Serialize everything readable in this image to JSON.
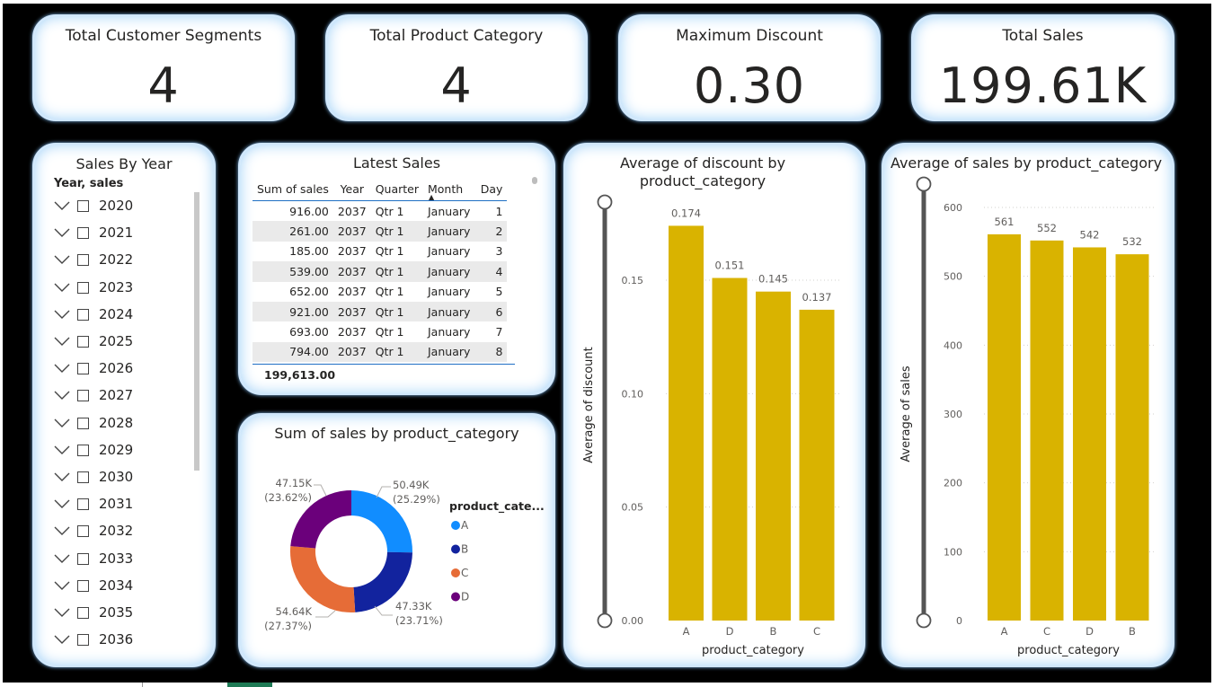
{
  "kpis": [
    {
      "title": "Total Customer Segments",
      "value": "4"
    },
    {
      "title": "Total Product Category",
      "value": "4"
    },
    {
      "title": "Maximum Discount",
      "value": "0.30"
    },
    {
      "title": "Total Sales",
      "value": "199.61K"
    }
  ],
  "slicer": {
    "title": "Sales By Year",
    "subtitle": "Year, sales",
    "years": [
      "2020",
      "2021",
      "2022",
      "2023",
      "2024",
      "2025",
      "2026",
      "2027",
      "2028",
      "2029",
      "2030",
      "2031",
      "2032",
      "2033",
      "2034",
      "2035",
      "2036"
    ]
  },
  "latest_sales": {
    "title": "Latest Sales",
    "columns": [
      "Sum of sales",
      "Year",
      "Quarter",
      "Month",
      "Day"
    ],
    "rows": [
      [
        "916.00",
        "2037",
        "Qtr 1",
        "January",
        "1"
      ],
      [
        "261.00",
        "2037",
        "Qtr 1",
        "January",
        "2"
      ],
      [
        "185.00",
        "2037",
        "Qtr 1",
        "January",
        "3"
      ],
      [
        "539.00",
        "2037",
        "Qtr 1",
        "January",
        "4"
      ],
      [
        "652.00",
        "2037",
        "Qtr 1",
        "January",
        "5"
      ],
      [
        "921.00",
        "2037",
        "Qtr 1",
        "January",
        "6"
      ],
      [
        "693.00",
        "2037",
        "Qtr 1",
        "January",
        "7"
      ],
      [
        "794.00",
        "2037",
        "Qtr 1",
        "January",
        "8"
      ]
    ],
    "total": "199,613.00"
  },
  "colors": {
    "bar": "#d9b300",
    "A": "#118dff",
    "B": "#12239e",
    "C": "#e66c37",
    "D": "#6b007b"
  },
  "chart_data": [
    {
      "id": "donut",
      "type": "pie",
      "title": "Sum of sales by product_category",
      "legend_title": "product_cate...",
      "legend_position": "right",
      "categories": [
        "A",
        "B",
        "C",
        "D"
      ],
      "values": [
        50.49,
        47.33,
        54.64,
        47.15
      ],
      "value_labels": [
        "50.49K",
        "47.33K",
        "54.64K",
        "47.15K"
      ],
      "percent_labels": [
        "(25.29%)",
        "(23.71%)",
        "(27.37%)",
        "(23.62%)"
      ]
    },
    {
      "id": "discount",
      "type": "bar",
      "title": "Average of discount by product_category",
      "xlabel": "product_category",
      "ylabel": "Average of discount",
      "categories": [
        "A",
        "D",
        "B",
        "C"
      ],
      "values": [
        0.174,
        0.151,
        0.145,
        0.137
      ],
      "value_labels": [
        "0.174",
        "0.151",
        "0.145",
        "0.137"
      ],
      "ylim": [
        0,
        0.19
      ],
      "yticks": [
        "0.00",
        "0.05",
        "0.10",
        "0.15"
      ],
      "ytick_values": [
        0,
        0.05,
        0.1,
        0.15
      ],
      "grid": true
    },
    {
      "id": "avgsales",
      "type": "bar",
      "title": "Average of sales by product_category",
      "xlabel": "product_category",
      "ylabel": "Average of sales",
      "categories": [
        "A",
        "C",
        "D",
        "B"
      ],
      "values": [
        561,
        552,
        542,
        532
      ],
      "value_labels": [
        "561",
        "552",
        "542",
        "532"
      ],
      "ylim": [
        0,
        600
      ],
      "yticks": [
        "0",
        "100",
        "200",
        "300",
        "400",
        "500",
        "600"
      ],
      "ytick_values": [
        0,
        100,
        200,
        300,
        400,
        500,
        600
      ],
      "grid": true
    }
  ]
}
